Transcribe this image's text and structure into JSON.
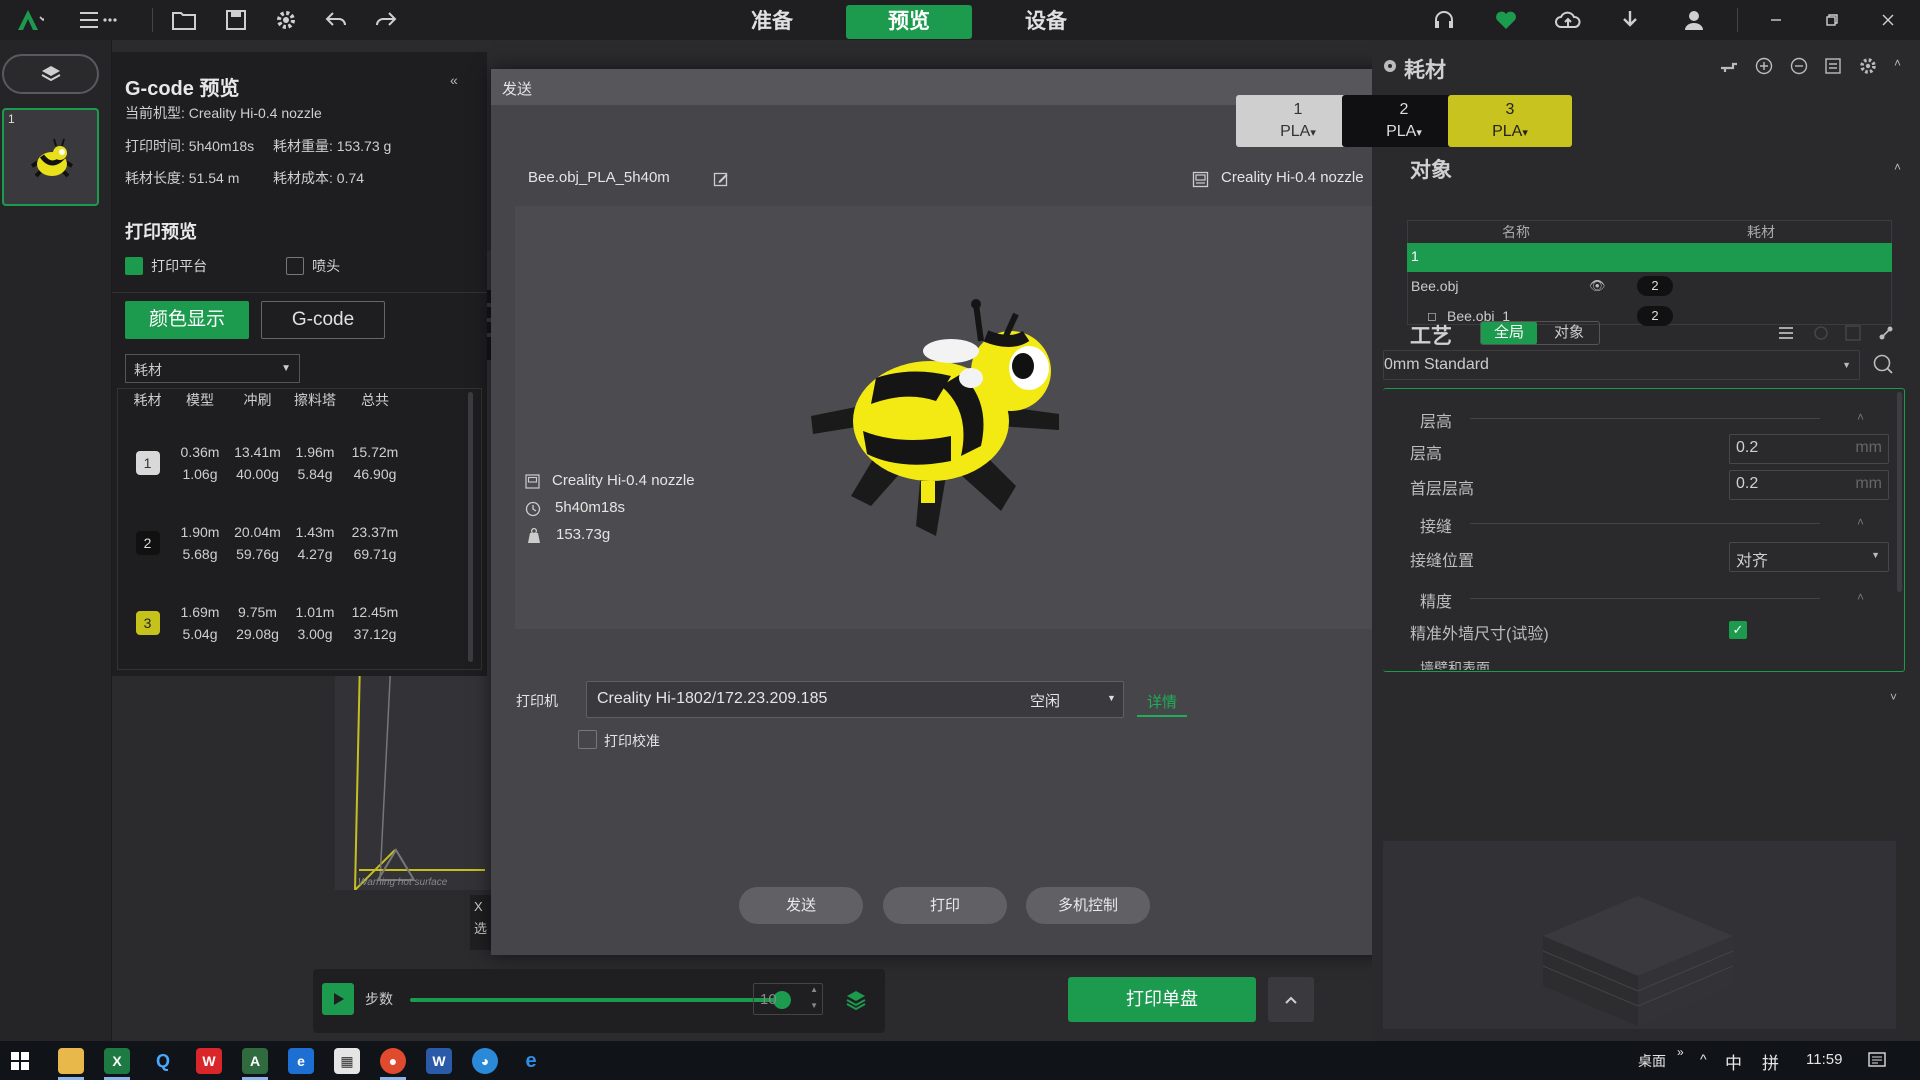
{
  "top_nav": {
    "tabs": [
      {
        "label": "准备"
      },
      {
        "label": "预览"
      },
      {
        "label": "设备"
      }
    ]
  },
  "plate": {
    "number": "1"
  },
  "gcode_panel": {
    "title": "G-code 预览",
    "printer_model": "当前机型: Creality Hi-0.4 nozzle",
    "print_time": "打印时间: 5h40m18s",
    "filament_weight": "耗材重量: 153.73 g",
    "filament_length": "耗材长度: 51.54 m",
    "filament_cost": "耗材成本: 0.74",
    "print_preview_title": "打印预览",
    "print_bed_label": "打印平台",
    "nozzle_label": "喷头",
    "color_display_button": "颜色显示",
    "gcode_button": "G-code",
    "dropdown_value": "耗材",
    "table": {
      "headers": [
        "耗材",
        "模型",
        "冲刷",
        "擦料塔",
        "总共"
      ],
      "rows": [
        {
          "id": "1",
          "color": "#d9d9d9",
          "text_color": "#333333",
          "model": [
            "0.36m",
            "1.06g"
          ],
          "flush": [
            "13.41m",
            "40.00g"
          ],
          "tower": [
            "1.96m",
            "5.84g"
          ],
          "total": [
            "15.72m",
            "46.90g"
          ]
        },
        {
          "id": "2",
          "color": "#111111",
          "text_color": "#dddddd",
          "model": [
            "1.90m",
            "5.68g"
          ],
          "flush": [
            "20.04m",
            "59.76g"
          ],
          "tower": [
            "1.43m",
            "4.27g"
          ],
          "total": [
            "23.37m",
            "69.71g"
          ]
        },
        {
          "id": "3",
          "color": "#c6c21c",
          "text_color": "#222222",
          "model": [
            "1.69m",
            "5.04g"
          ],
          "flush": [
            "9.75m",
            "29.08g"
          ],
          "tower": [
            "1.01m",
            "3.00g"
          ],
          "total": [
            "12.45m",
            "37.12g"
          ]
        }
      ]
    }
  },
  "scene": {
    "bed_warning": "Warning hot surface",
    "partial_text": "X",
    "partial_text2": "选"
  },
  "dialog": {
    "title": "发送",
    "file_name": "Bee.obj_PLA_5h40m",
    "printer_header": "Creality Hi-0.4 nozzle",
    "info_printer": "Creality Hi-0.4 nozzle",
    "info_time": "5h40m18s",
    "info_weight": "153.73g",
    "printer_label": "打印机",
    "printer_value": "Creality Hi-1802/172.23.209.185",
    "printer_status": "空闲",
    "details_link": "详情",
    "calibration_label": "打印校准",
    "buttons": {
      "send": "发送",
      "print": "打印",
      "multi": "多机控制"
    }
  },
  "right_panel": {
    "filament_title": "耗材",
    "filaments": [
      {
        "num": "1",
        "type": "PLA",
        "color": "#cfcfcf",
        "text_color": "#333333"
      },
      {
        "num": "2",
        "type": "PLA",
        "color": "#101012",
        "text_color": "#dddddd"
      },
      {
        "num": "3",
        "type": "PLA",
        "color": "#c9c31f",
        "text_color": "#222222"
      }
    ],
    "objects_title": "对象",
    "objects_headers": [
      "名称",
      "耗材"
    ],
    "plate_row": "1",
    "objects": [
      {
        "name": "Bee.obj",
        "filament": "2"
      },
      {
        "name": "Bee.obj_1",
        "filament": "2"
      }
    ],
    "process_title": "工艺",
    "process_tabs": [
      "全局",
      "对象"
    ],
    "preset": "0mm Standard",
    "group_layer_height": "层高",
    "layer_height_label": "层高",
    "layer_height_value": "0.2",
    "first_layer_label": "首层层高",
    "first_layer_value": "0.2",
    "unit": "mm",
    "group_seam": "接缝",
    "seam_position_label": "接缝位置",
    "seam_position_value": "对齐",
    "group_precision": "精度",
    "precise_wall_label": "精准外墙尺寸(试验)",
    "partial_next": "墙壁和表面"
  },
  "bottom": {
    "steps_label": "步数",
    "step_value": "10",
    "slider_fraction": 0.98,
    "print_plate_button": "打印单盘"
  },
  "taskbar": {
    "desktop_label": "桌面",
    "ime_mode": "中",
    "ime_alt": "拼",
    "time": "11:59"
  }
}
